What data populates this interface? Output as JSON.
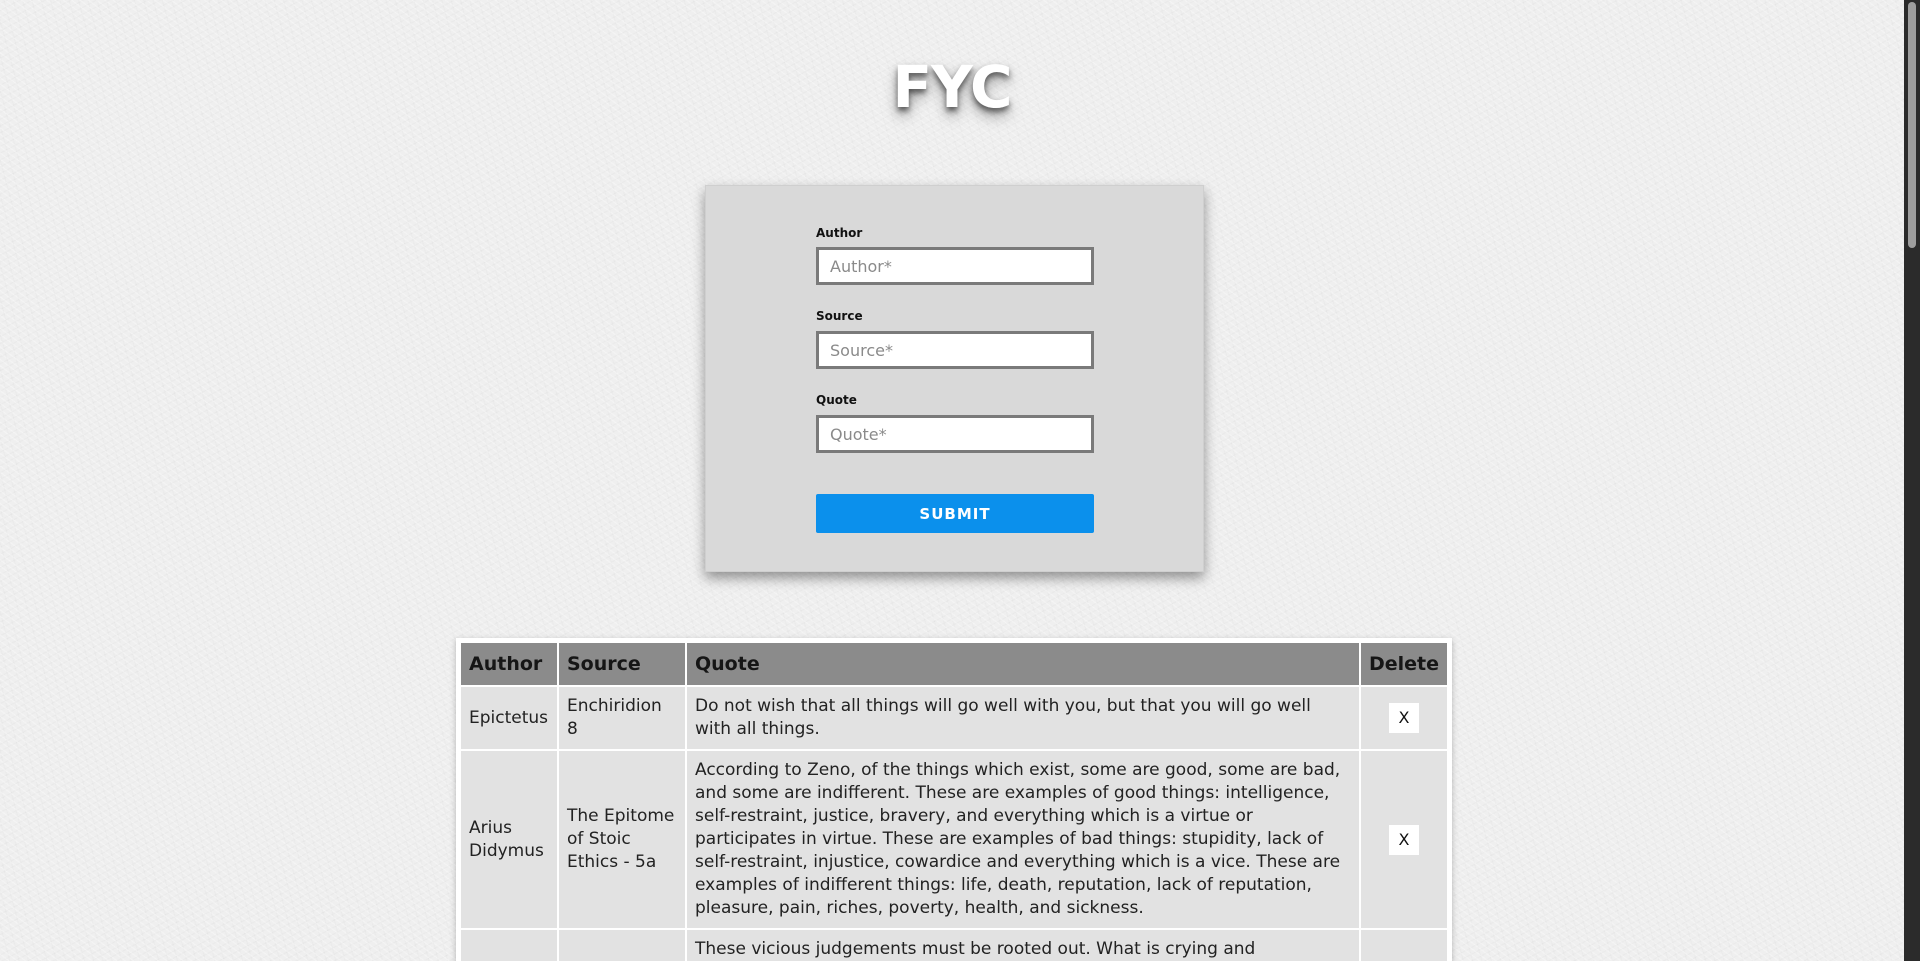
{
  "header": {
    "title": "FYC"
  },
  "form": {
    "author_label": "Author",
    "author_placeholder": "Author*",
    "author_value": "",
    "source_label": "Source",
    "source_placeholder": "Source*",
    "source_value": "",
    "quote_label": "Quote",
    "quote_placeholder": "Quote*",
    "quote_value": "",
    "submit_label": "SUBMIT"
  },
  "table": {
    "headers": [
      "Author",
      "Source",
      "Quote",
      "Delete"
    ],
    "rows": [
      {
        "author": "Epictetus",
        "source": "Enchiridion 8",
        "quote": "Do not wish that all things will go well with you, but that you will go well with all things.",
        "delete_label": "X"
      },
      {
        "author": "Arius Didymus",
        "source": "The Epitome of Stoic Ethics - 5a",
        "quote": "According to Zeno, of the things which exist, some are good, some are bad, and some are indifferent. These are examples of good things: intelligence, self-restraint, justice, bravery, and everything which is a virtue or participates in virtue. These are examples of bad things: stupidity, lack of self-restraint, injustice, cowardice and everything which is a vice. These are examples of indifferent things: life, death, reputation, lack of reputation, pleasure, pain, riches, poverty, health, and sickness.",
        "delete_label": "X"
      },
      {
        "author": "",
        "source": "",
        "quote": "These vicious judgements must be rooted out. What is crying and",
        "delete_label": ""
      }
    ]
  },
  "colors": {
    "accent": "#0b90ec",
    "table_header": "#8b8b8b",
    "table_cell": "#e2e2e2",
    "card": "#d9d9d9"
  }
}
